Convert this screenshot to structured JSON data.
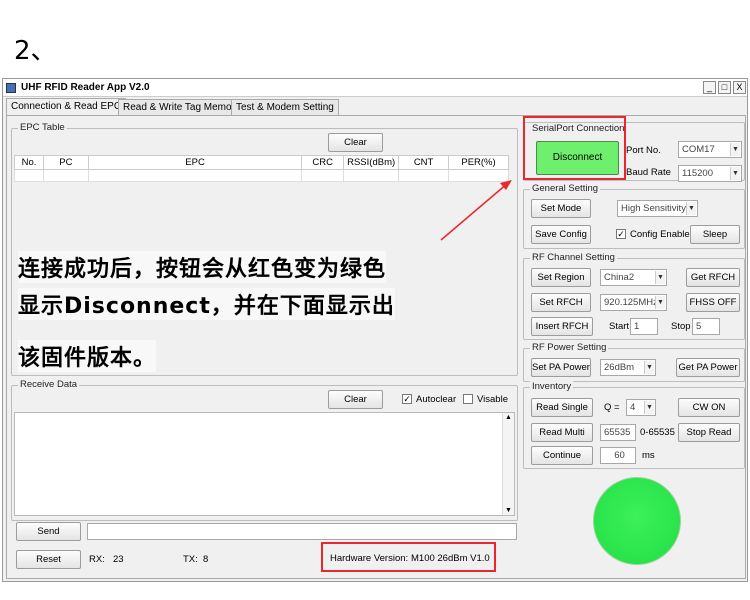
{
  "heading": "2、",
  "window": {
    "title": "UHF RFID Reader App V2.0",
    "controls": [
      "_",
      "□",
      "X"
    ]
  },
  "tabs": [
    "Connection & Read EPC",
    "Read & Write Tag Memory",
    "Test & Modem Setting"
  ],
  "epc_table": {
    "title": "EPC Table",
    "clear_label": "Clear",
    "columns": [
      "No.",
      "PC",
      "EPC",
      "CRC",
      "RSSI(dBm)",
      "CNT",
      "PER(%)"
    ]
  },
  "receive": {
    "title": "Receive Data",
    "clear_label": "Clear",
    "autoclear_label": "Autoclear",
    "autoclear_checked": "✓",
    "visable_label": "Visable",
    "send_label": "Send",
    "reset_label": "Reset",
    "rx_label": "RX:",
    "rx_value": "23",
    "tx_label": "TX:",
    "tx_value": "8",
    "hw_label": "Hardware Version:",
    "hw_value": "M100 26dBm V1.0"
  },
  "serial": {
    "title": "SerialPort Connection",
    "connect_label": "Disconnect",
    "connect_color": "#6ef06e",
    "port_label": "Port No.",
    "port_value": "COM17",
    "baud_label": "Baud Rate",
    "baud_value": "115200"
  },
  "general": {
    "title": "General Setting",
    "set_mode": "Set Mode",
    "mode_value": "High Sensitivity",
    "save_config": "Save Config",
    "config_enable": "Config Enable",
    "config_checked": "✓",
    "sleep": "Sleep"
  },
  "rf_channel": {
    "title": "RF Channel Setting",
    "set_region": "Set Region",
    "region_value": "China2",
    "get_rfch": "Get RFCH",
    "set_rfch": "Set RFCH",
    "rfch_value": "920.125MHz",
    "fhss_off": "FHSS OFF",
    "insert_rfch": "Insert RFCH",
    "start_label": "Start",
    "start_value": "1",
    "stop_label": "Stop",
    "stop_value": "5"
  },
  "rf_power": {
    "title": "RF Power Setting",
    "set_pa": "Set PA Power",
    "pa_value": "26dBm",
    "get_pa": "Get PA Power"
  },
  "inventory": {
    "title": "Inventory",
    "read_single": "Read Single",
    "q_label": "Q =",
    "q_value": "4",
    "cw_on": "CW ON",
    "read_multi": "Read Multi",
    "multi_value": "65535",
    "multi_range": "0-65535",
    "stop_read": "Stop Read",
    "continue": "Continue",
    "continue_value": "60",
    "ms_label": "ms"
  },
  "status_led_color": "#22dd44",
  "annotation": {
    "line1": "连接成功后，按钮会从红色变为绿色",
    "line2": "显示Disconnect，并在下面显示出",
    "line3": "该固件版本。",
    "color": "#e8282b"
  }
}
